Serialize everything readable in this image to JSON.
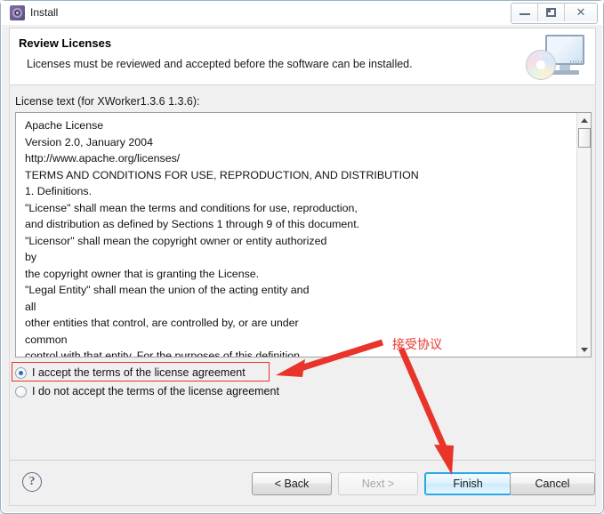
{
  "window": {
    "title": "Install",
    "icon": "gear-icon",
    "controls": {
      "minimize": "minimize-icon",
      "maximize": "restore-icon",
      "close": "close-icon"
    }
  },
  "header": {
    "title": "Review Licenses",
    "subtitle": "Licenses must be reviewed and accepted before the software can be installed.",
    "icon": "computer-disc-icon"
  },
  "license": {
    "label": "License text (for XWorker1.3.6 1.3.6):",
    "text": "Apache License\nVersion 2.0, January 2004\nhttp://www.apache.org/licenses/\nTERMS AND CONDITIONS FOR USE, REPRODUCTION, AND DISTRIBUTION\n1. Definitions.\n\"License\" shall mean the terms and conditions for use, reproduction,\nand distribution as defined by Sections 1 through 9 of this document.\n\"Licensor\" shall mean the copyright owner or entity authorized\nby\nthe copyright owner that is granting the License.\n\"Legal Entity\" shall mean the union of the acting entity and\nall\nother entities that control, are controlled by, or are under\ncommon\ncontrol with that entity. For the purposes of this definition,",
    "scrollbar": {
      "up_arrow": "scroll-up-icon",
      "down_arrow": "scroll-down-icon"
    }
  },
  "radio": {
    "accept_label": "I accept the terms of the license agreement",
    "decline_label": "I do not accept the terms of the license agreement",
    "selected": "accept"
  },
  "footer": {
    "help_label": "?",
    "back_label": "< Back",
    "next_label": "Next >",
    "finish_label": "Finish",
    "cancel_label": "Cancel"
  },
  "annotation": {
    "text": "接受协议",
    "color": "#e8342a"
  },
  "colors": {
    "accent": "#2aa8e8",
    "annotation": "#e8342a",
    "radio_dot": "#2b6fbd",
    "window_bg": "#f0f0f0"
  }
}
